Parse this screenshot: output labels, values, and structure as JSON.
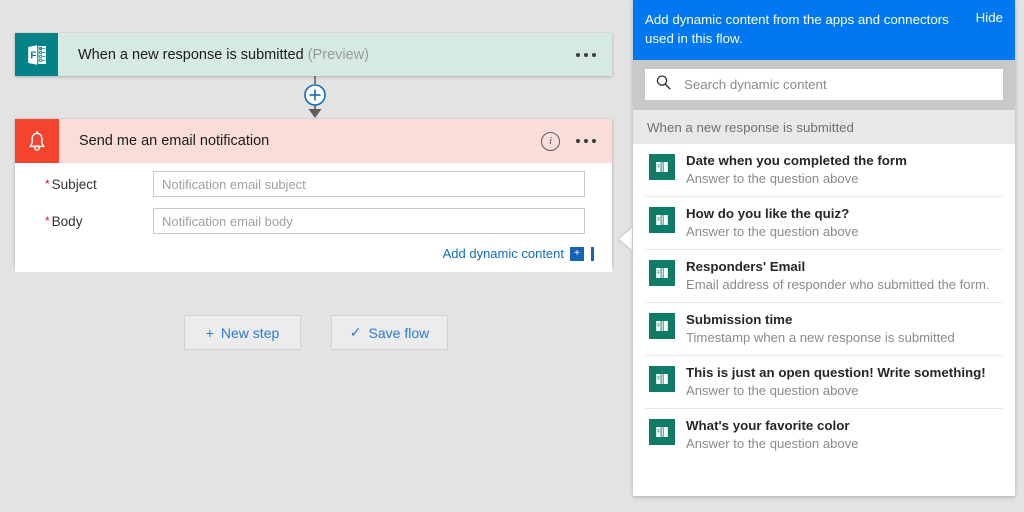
{
  "designer": {
    "trigger_card": {
      "icon": "microsoft-forms-icon",
      "title": "When a new response is submitted",
      "preview_tag": "(Preview)",
      "menu_icon": "ellipsis-icon"
    },
    "connector": {
      "add_icon": "plus-circle-icon",
      "arrow_icon": "arrow-down-icon"
    },
    "action_card": {
      "icon": "bell-icon",
      "title": "Send me an email notification",
      "info_icon": "info-circle-icon",
      "menu_icon": "ellipsis-icon",
      "fields": [
        {
          "label": "Subject",
          "required": true,
          "value": "",
          "placeholder": "Notification email subject"
        },
        {
          "label": "Body",
          "required": true,
          "value": "",
          "placeholder": "Notification email body"
        }
      ],
      "dynamic_content_link": "Add dynamic content",
      "dynamic_content_btn_icon": "plus-icon"
    },
    "buttons": [
      {
        "glyph": "+",
        "label": "New step",
        "name": "new-step-button"
      },
      {
        "glyph": "✓",
        "label": "Save flow",
        "name": "save-flow-button"
      }
    ]
  },
  "dynamic_panel": {
    "banner": {
      "text": "Add dynamic content from the apps and connectors used in this flow.",
      "hide_label": "Hide"
    },
    "search": {
      "icon": "search-icon",
      "value": "",
      "placeholder": "Search dynamic content"
    },
    "group_header": "When a new response is submitted",
    "items": [
      {
        "icon": "microsoft-forms-icon",
        "title": "Date when you completed the form",
        "subtitle": "Answer to the question above"
      },
      {
        "icon": "microsoft-forms-icon",
        "title": "How do you like the quiz?",
        "subtitle": "Answer to the question above"
      },
      {
        "icon": "microsoft-forms-icon",
        "title": "Responders' Email",
        "subtitle": "Email address of responder who submitted the form."
      },
      {
        "icon": "microsoft-forms-icon",
        "title": "Submission time",
        "subtitle": "Timestamp when a new response is submitted"
      },
      {
        "icon": "microsoft-forms-icon",
        "title": "This is just an open question! Write something!",
        "subtitle": "Answer to the question above"
      },
      {
        "icon": "microsoft-forms-icon",
        "title": "What's your favorite color",
        "subtitle": "Answer to the question above"
      }
    ]
  },
  "colors": {
    "page_background": "#e3e3e3",
    "trigger_header": "#d7e9e4",
    "forms_teal": "#038387",
    "action_header": "#fadcd9",
    "bell_red": "#f4442e",
    "banner_blue": "#0078f2",
    "link_blue": "#0f6cbd",
    "button_blue": "#2b7cd3",
    "required_red": "#e81123",
    "item_icon_teal": "#0f7c68"
  }
}
